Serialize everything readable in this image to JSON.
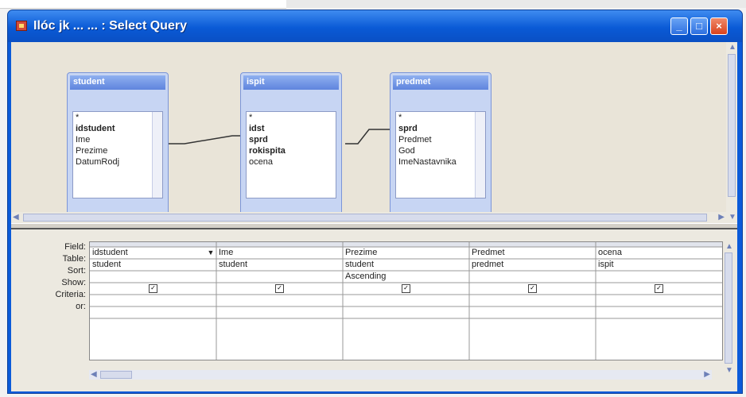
{
  "window": {
    "title": "Ilóc jk ... ...  : Select Query",
    "minimize_glyph": "_",
    "maximize_glyph": "□",
    "close_glyph": "×",
    "icon": "query-icon"
  },
  "tables": [
    {
      "name": "student",
      "fields": [
        {
          "label": "*",
          "bold": false
        },
        {
          "label": "idstudent",
          "bold": true
        },
        {
          "label": "Ime",
          "bold": false
        },
        {
          "label": "Prezime",
          "bold": false
        },
        {
          "label": "DatumRodj",
          "bold": false
        }
      ]
    },
    {
      "name": "ispit",
      "fields": [
        {
          "label": "*",
          "bold": false
        },
        {
          "label": "idst",
          "bold": true
        },
        {
          "label": "sprd",
          "bold": true
        },
        {
          "label": "rokispita",
          "bold": true
        },
        {
          "label": "ocena",
          "bold": false
        }
      ]
    },
    {
      "name": "predmet",
      "fields": [
        {
          "label": "*",
          "bold": false
        },
        {
          "label": "sprd",
          "bold": true
        },
        {
          "label": "Predmet",
          "bold": false
        },
        {
          "label": "God",
          "bold": false
        },
        {
          "label": "ImeNastavnika",
          "bold": false
        }
      ]
    }
  ],
  "grid": {
    "row_labels": [
      "Field:",
      "Table:",
      "Sort:",
      "Show:",
      "Criteria:",
      "or:"
    ],
    "columns": [
      {
        "field": "idstudent",
        "table": "student",
        "sort": "",
        "show": true
      },
      {
        "field": "Ime",
        "table": "student",
        "sort": "",
        "show": true
      },
      {
        "field": "Prezime",
        "table": "student",
        "sort": "Ascending",
        "show": true
      },
      {
        "field": "Predmet",
        "table": "predmet",
        "sort": "",
        "show": true
      },
      {
        "field": "ocena",
        "table": "ispit",
        "sort": "",
        "show": true
      }
    ]
  },
  "colors": {
    "titlebar": "#0a5ad6",
    "table_header": "#5f84de",
    "window_bg": "#e9e4d8"
  }
}
